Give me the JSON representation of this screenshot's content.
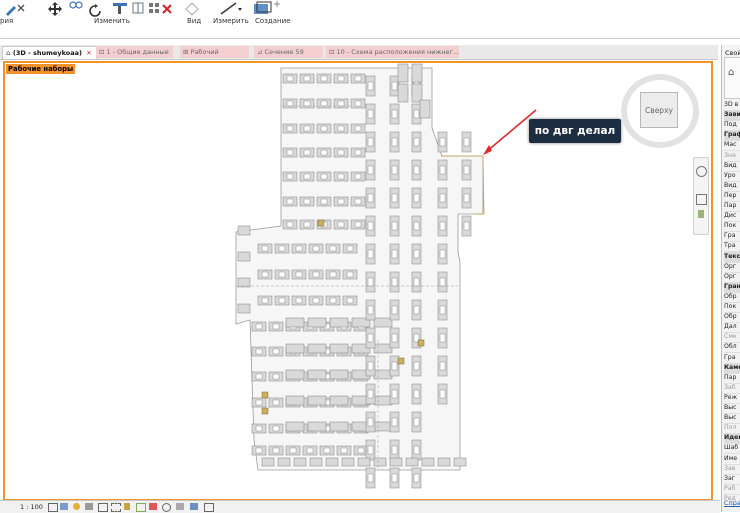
{
  "ribbon": {
    "left_label": "рия",
    "modify_label": "Изменить",
    "view_label": "Вид",
    "measure_label": "Измерить",
    "create_label": "Создание"
  },
  "tabs": [
    {
      "label": "(3D - shumeykoaa)",
      "close": "✕"
    },
    {
      "label": "1 - Общие данные"
    },
    {
      "label": "Рабочий"
    },
    {
      "label": "Сечение 59"
    },
    {
      "label": "10 - Схема расположения нижнег..."
    }
  ],
  "viewport": {
    "worksets_label": "Рабочие наборы",
    "callout_text": "по двг делал",
    "viewcube_label": "Сверху",
    "accent_color": "#f4922a",
    "callout_color": "#1d2e43",
    "arrow_color": "#e0282c"
  },
  "right_panel": {
    "title": "Свой",
    "rows": [
      {
        "t": "3D в",
        "k": "plain"
      },
      {
        "t": "Зави",
        "k": "hdr"
      },
      {
        "t": "Под",
        "k": "plain"
      },
      {
        "t": "Граф",
        "k": "hdr"
      },
      {
        "t": "Мас",
        "k": "plain"
      },
      {
        "t": "Зна",
        "k": "grey"
      },
      {
        "t": "Вид",
        "k": "plain"
      },
      {
        "t": "Уро",
        "k": "plain"
      },
      {
        "t": "Вид",
        "k": "plain"
      },
      {
        "t": "Пер",
        "k": "plain"
      },
      {
        "t": "Пар",
        "k": "plain"
      },
      {
        "t": "Дис",
        "k": "plain"
      },
      {
        "t": "Пок",
        "k": "plain"
      },
      {
        "t": "Гра",
        "k": "plain"
      },
      {
        "t": "Тра",
        "k": "plain"
      },
      {
        "t": "Текс",
        "k": "hdr"
      },
      {
        "t": "Орг",
        "k": "plain"
      },
      {
        "t": "Орг",
        "k": "plain"
      },
      {
        "t": "Гран",
        "k": "hdr"
      },
      {
        "t": "Обр",
        "k": "plain"
      },
      {
        "t": "Пок",
        "k": "plain"
      },
      {
        "t": "Обр",
        "k": "plain"
      },
      {
        "t": "Дал",
        "k": "plain"
      },
      {
        "t": "Смк",
        "k": "grey"
      },
      {
        "t": "Обл",
        "k": "plain"
      },
      {
        "t": "Гра",
        "k": "plain"
      },
      {
        "t": "Каме",
        "k": "hdr"
      },
      {
        "t": "Пар",
        "k": "plain"
      },
      {
        "t": "Заб",
        "k": "grey"
      },
      {
        "t": "Реж",
        "k": "plain"
      },
      {
        "t": "Выс",
        "k": "plain"
      },
      {
        "t": "Выс",
        "k": "plain"
      },
      {
        "t": "Пол",
        "k": "grey"
      },
      {
        "t": "Иден",
        "k": "hdr"
      },
      {
        "t": "Шаб",
        "k": "plain"
      },
      {
        "t": "Име",
        "k": "plain"
      },
      {
        "t": "Зав",
        "k": "grey"
      },
      {
        "t": "Заг",
        "k": "plain"
      },
      {
        "t": "Раб",
        "k": "grey"
      },
      {
        "t": "Ред",
        "k": "grey"
      }
    ],
    "help_link": "Спра"
  },
  "status": {
    "scale": "1 : 100"
  }
}
